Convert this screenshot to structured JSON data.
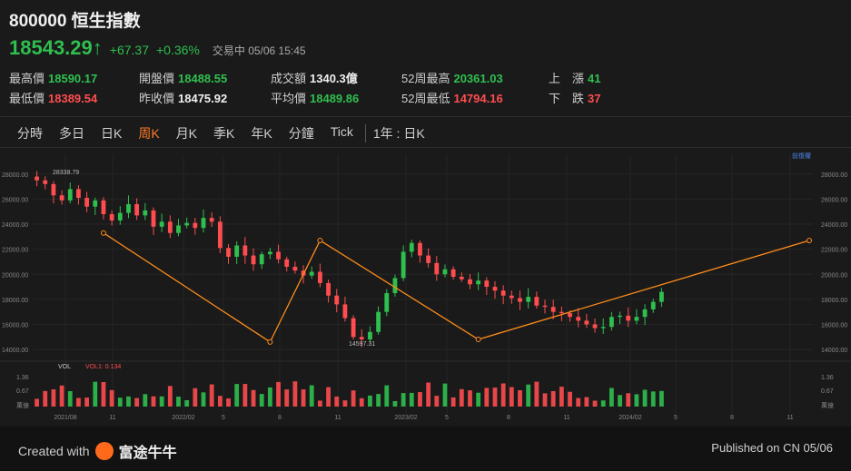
{
  "header": {
    "title": "800000 恒生指數",
    "price": "18543.29",
    "arrow": "↑",
    "change": "+67.37",
    "change_pct": "+0.36%",
    "status": "交易中 05/06 15:45"
  },
  "stats": {
    "high": {
      "label": "最高價",
      "value": "18590.17"
    },
    "low": {
      "label": "最低價",
      "value": "18389.54"
    },
    "open": {
      "label": "開盤價",
      "value": "18488.55"
    },
    "prev_close": {
      "label": "昨收價",
      "value": "18475.92"
    },
    "turnover": {
      "label": "成交額",
      "value": "1340.3億"
    },
    "avg": {
      "label": "平均價",
      "value": "18489.86"
    },
    "wk52_high": {
      "label": "52周最高",
      "value": "20361.03"
    },
    "wk52_low": {
      "label": "52周最低",
      "value": "14794.16"
    },
    "up": {
      "label": "上　漲",
      "value": "41"
    },
    "down": {
      "label": "下　跌",
      "value": "37"
    }
  },
  "tabs": [
    "分時",
    "多日",
    "日K",
    "周K",
    "月K",
    "季K",
    "年K",
    "分鐘",
    "Tick",
    "1年 : 日K"
  ],
  "active_tab": "周K",
  "colors": {
    "up": "#ff4d4f",
    "down": "#2fbf4f",
    "accent": "#ff7a2a",
    "trend": "#ff8c1a"
  },
  "chart_data": {
    "type": "candlestick",
    "yticks": [
      "28000.00",
      "26000.00",
      "24000.00",
      "22000.00",
      "20000.00",
      "18000.00",
      "16000.00",
      "14000.00"
    ],
    "ylim": [
      13500,
      29000
    ],
    "xticks": [
      "2021/08",
      "11",
      "2022/02",
      "5",
      "8",
      "11",
      "2023/02",
      "5",
      "8",
      "11",
      "2024/02",
      "5",
      "8",
      "11"
    ],
    "annotations": [
      "28338.79",
      "14597.31"
    ],
    "adjust_label": "前復權",
    "trend_points": [
      [
        8,
        23300
      ],
      [
        28,
        14597
      ],
      [
        34,
        22700
      ],
      [
        53,
        14800
      ],
      [
        72,
        22700
      ]
    ],
    "closes": [
      27500,
      27200,
      26300,
      25900,
      26800,
      26100,
      25400,
      25900,
      24800,
      24300,
      24900,
      25600,
      24700,
      25100,
      23800,
      24200,
      23300,
      23900,
      24100,
      23700,
      24500,
      24200,
      22100,
      21400,
      22300,
      21500,
      20800,
      21600,
      21800,
      21200,
      20600,
      20300,
      19900,
      20200,
      19300,
      18300,
      17600,
      16500,
      15000,
      14800,
      15400,
      17000,
      18500,
      19700,
      21800,
      22500,
      21500,
      20900,
      20000,
      20400,
      19800,
      19600,
      19200,
      19500,
      19000,
      18700,
      18300,
      18100,
      17800,
      18200,
      17500,
      17400,
      17000,
      16900,
      16600,
      16300,
      16000,
      15700,
      15800,
      16600,
      16700,
      16300,
      16600,
      17200,
      17800,
      18600
    ],
    "volume": {
      "label": "VOL",
      "series_label": "VOL1: 0.134",
      "yticks": [
        "1.36",
        "0.67",
        "萬億"
      ]
    }
  },
  "footer": {
    "created_with": "Created with",
    "brand": "富途牛牛",
    "published": "Published on CN 05/06"
  }
}
